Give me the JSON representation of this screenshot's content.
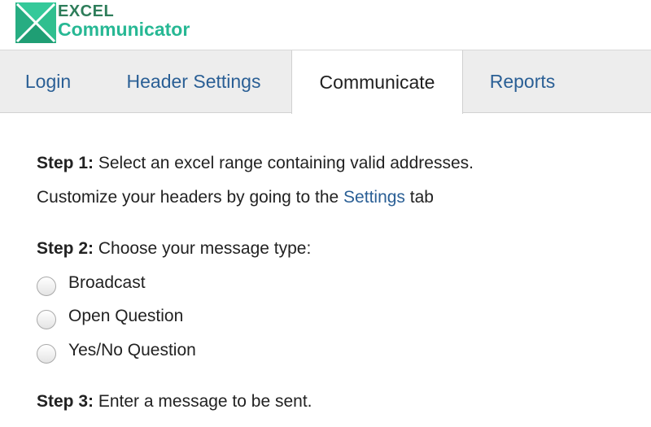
{
  "logo": {
    "line1": "EXCEL",
    "line2": "Communicator"
  },
  "tabs": [
    {
      "label": "Login",
      "active": false
    },
    {
      "label": "Header Settings",
      "active": false
    },
    {
      "label": "Communicate",
      "active": true
    },
    {
      "label": "Reports",
      "active": false
    }
  ],
  "step1": {
    "label": "Step 1:",
    "text": " Select an excel range containing valid addresses.",
    "customize_prefix": "Customize your headers by going to the ",
    "settings_link": "Settings",
    "customize_suffix": " tab"
  },
  "step2": {
    "label": "Step 2:",
    "text": " Choose your message type:",
    "options": [
      "Broadcast",
      "Open Question",
      "Yes/No Question"
    ]
  },
  "step3": {
    "label": "Step 3:",
    "text": " Enter a message to be sent."
  },
  "colors": {
    "brand_dark": "#2e7d5a",
    "brand_light": "#27b894",
    "link": "#2a5f95",
    "tab_bar": "#ededed"
  }
}
